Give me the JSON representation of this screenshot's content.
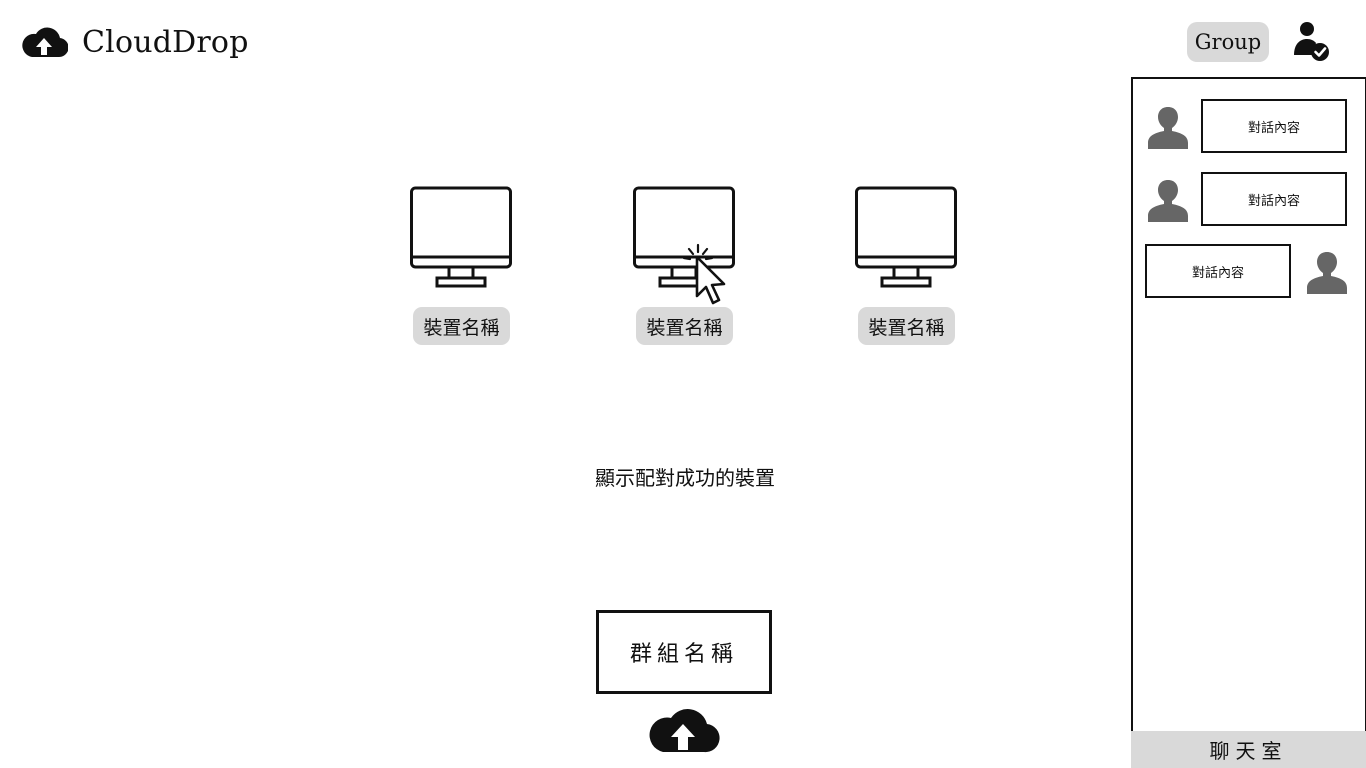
{
  "header": {
    "brand_icon": "cloud-upload-icon",
    "title": "CloudDrop",
    "group_button_label": "Group",
    "user_icon": "user-check-icon"
  },
  "devices": [
    {
      "name": "裝置名稱",
      "icon": "monitor-icon"
    },
    {
      "name": "裝置名稱",
      "icon": "monitor-icon",
      "hovered": true
    },
    {
      "name": "裝置名稱",
      "icon": "monitor-icon"
    }
  ],
  "status_text": "顯示配對成功的裝置",
  "group_name": "群組名稱",
  "upload_icon": "cloud-upload-icon",
  "chat": {
    "messages": [
      {
        "side": "left",
        "text": "對話內容"
      },
      {
        "side": "left",
        "text": "對話內容"
      },
      {
        "side": "right",
        "text": "對話內容"
      }
    ],
    "tab_label": "聊天室"
  },
  "colors": {
    "label_bg": "#d9d9d9",
    "ink": "#111111",
    "avatar_gray": "#666666"
  }
}
